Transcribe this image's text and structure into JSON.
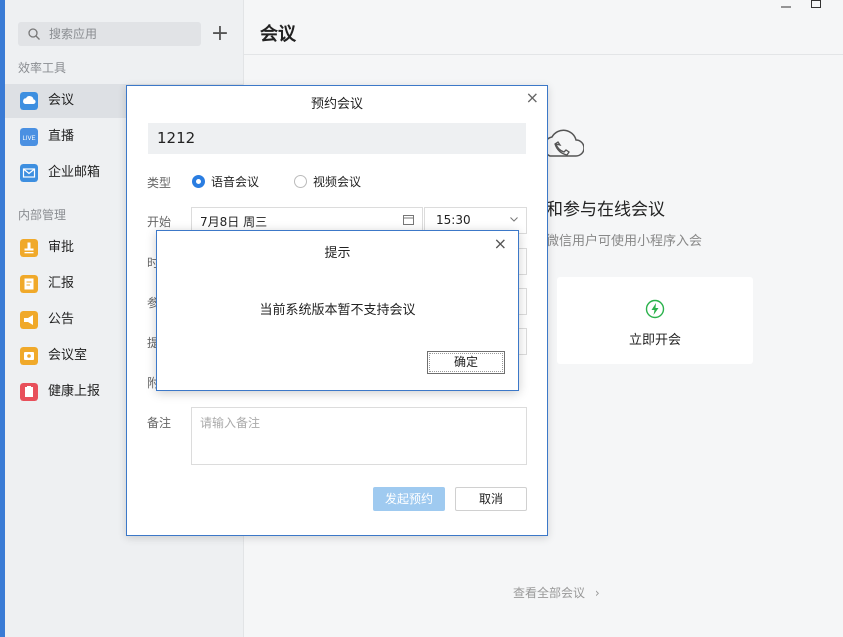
{
  "sidebar": {
    "search_placeholder": "搜索应用",
    "sections": [
      {
        "title": "效率工具",
        "items": [
          {
            "label": "会议",
            "icon": "cloud-icon",
            "color": "#3d8fe0",
            "active": true
          },
          {
            "label": "直播",
            "icon": "live-icon",
            "color": "#4a90e2"
          },
          {
            "label": "企业邮箱",
            "icon": "mail-icon",
            "color": "#3d8fe0"
          }
        ]
      },
      {
        "title": "内部管理",
        "items": [
          {
            "label": "审批",
            "icon": "stamp-icon",
            "color": "#f0a92a"
          },
          {
            "label": "汇报",
            "icon": "report-icon",
            "color": "#f0a92a"
          },
          {
            "label": "公告",
            "icon": "megaphone-icon",
            "color": "#f0a92a"
          },
          {
            "label": "会议室",
            "icon": "meeting-room-icon",
            "color": "#f0a92a"
          },
          {
            "label": "健康上报",
            "icon": "health-icon",
            "color": "#e8505b"
          }
        ]
      }
    ],
    "live_badge": "LIVE"
  },
  "main": {
    "title": "会议",
    "heading_partial": "和参与在线会议",
    "sub_partial": "微信用户可使用小程序入会",
    "start_now": "立即开会",
    "view_all": "查看全部会议"
  },
  "booking_dialog": {
    "title": "预约会议",
    "subject_value": "1212",
    "type_label": "类型",
    "type_options": [
      "语音会议",
      "视频会议"
    ],
    "start_label": "开始",
    "start_date": "7月8日 周三",
    "start_time": "15:30",
    "hidden_labels": [
      "时",
      "参",
      "提",
      "附"
    ],
    "notes_label": "备注",
    "notes_placeholder": "请输入备注",
    "submit_label": "发起预约",
    "cancel_label": "取消"
  },
  "alert_dialog": {
    "title": "提示",
    "message": "当前系统版本暂不支持会议",
    "ok_label": "确定"
  },
  "colors": {
    "accent": "#2a7de1",
    "dialog_border": "#3c78c8",
    "start_now_icon": "#2bb24c"
  }
}
